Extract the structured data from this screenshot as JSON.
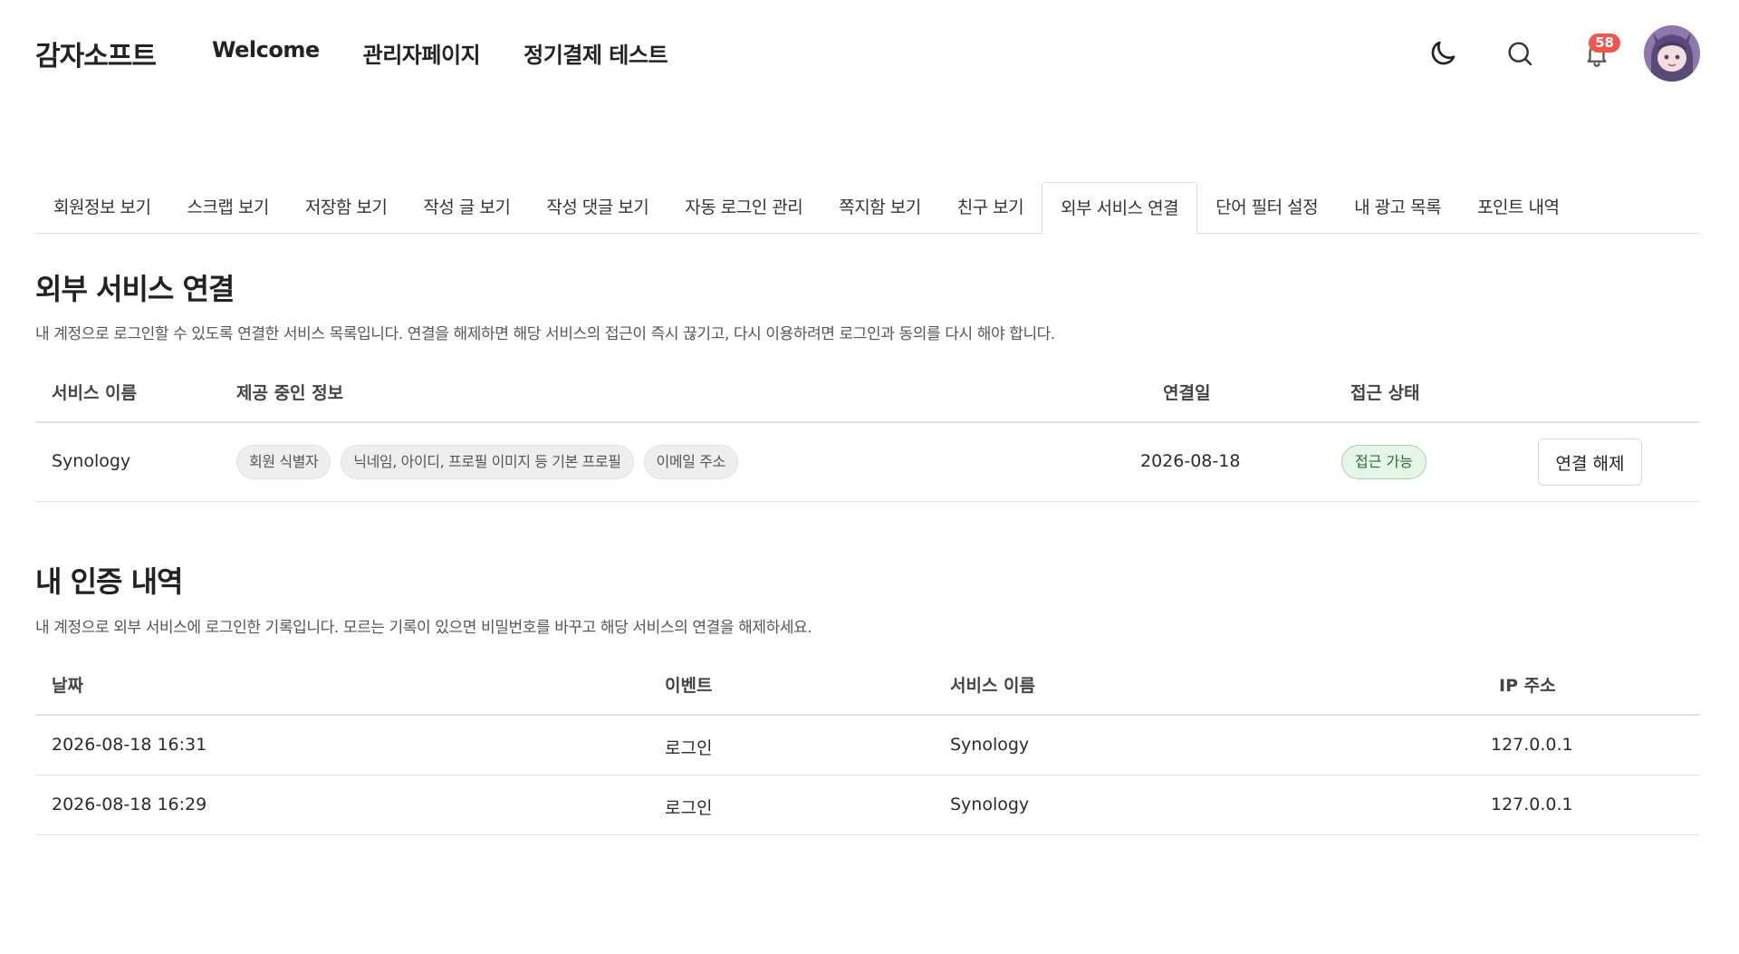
{
  "header": {
    "logo": "감자소프트",
    "nav": [
      "Welcome",
      "관리자페이지",
      "정기결제 테스트"
    ],
    "notification_count": "58"
  },
  "tabs": [
    "회원정보 보기",
    "스크랩 보기",
    "저장함 보기",
    "작성 글 보기",
    "작성 댓글 보기",
    "자동 로그인 관리",
    "쪽지함 보기",
    "친구 보기",
    "외부 서비스 연결",
    "단어 필터 설정",
    "내 광고 목록",
    "포인트 내역"
  ],
  "active_tab": 8,
  "connections": {
    "title": "외부 서비스 연결",
    "description": "내 계정으로 로그인할 수 있도록 연결한 서비스 목록입니다. 연결을 해제하면 해당 서비스의 접근이 즉시 끊기고, 다시 이용하려면 로그인과 동의를 다시 해야 합니다.",
    "headers": {
      "service": "서비스 이름",
      "info": "제공 중인 정보",
      "date": "연결일",
      "status": "접근 상태"
    },
    "rows": [
      {
        "service": "Synology",
        "info": [
          "회원 식별자",
          "닉네임, 아이디, 프로필 이미지 등 기본 프로필",
          "이메일 주소"
        ],
        "date": "2026-08-18",
        "status": "접근 가능",
        "action": "연결 해제"
      }
    ]
  },
  "auth_history": {
    "title": "내 인증 내역",
    "description": "내 계정으로 외부 서비스에 로그인한 기록입니다. 모르는 기록이 있으면 비밀번호를 바꾸고 해당 서비스의 연결을 해제하세요.",
    "headers": {
      "date": "날짜",
      "event": "이벤트",
      "service": "서비스 이름",
      "ip": "IP 주소"
    },
    "rows": [
      {
        "date": "2026-08-18 16:31",
        "event": "로그인",
        "service": "Synology",
        "ip": "127.0.0.1"
      },
      {
        "date": "2026-08-18 16:29",
        "event": "로그인",
        "service": "Synology",
        "ip": "127.0.0.1"
      }
    ]
  },
  "colors": {
    "badge": "#f0554f",
    "status_bg": "#e5f5e7",
    "status_border": "#9fd3a6"
  }
}
